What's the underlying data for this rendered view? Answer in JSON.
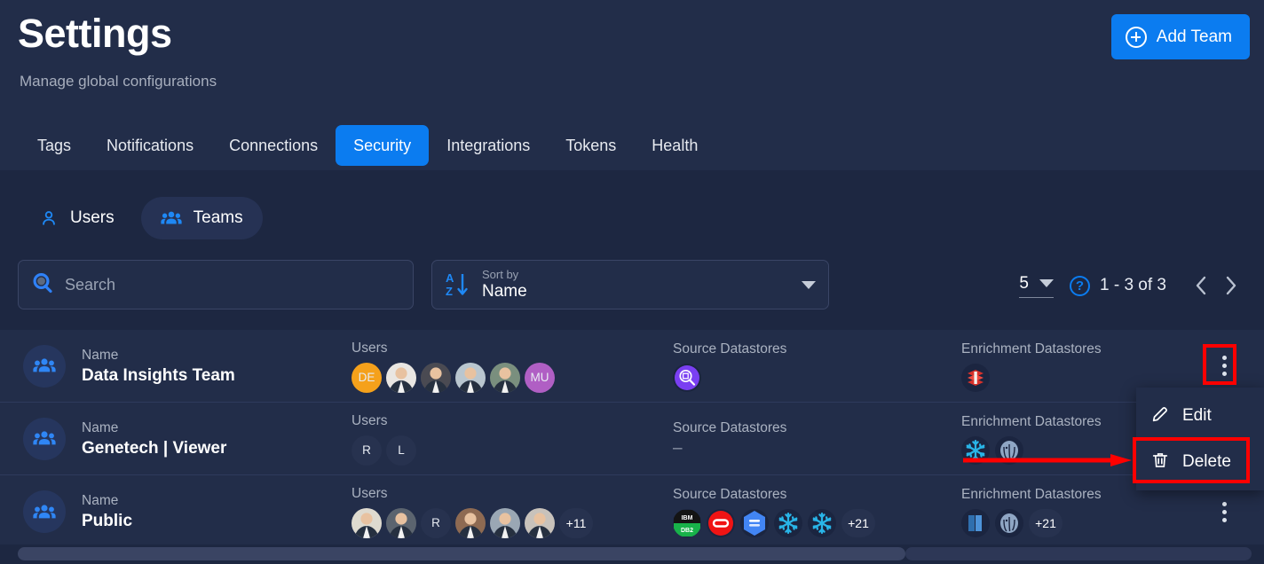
{
  "header": {
    "title": "Settings",
    "subtitle": "Manage global configurations",
    "add_team_label": "Add Team",
    "add_icon": "plus-circle-icon"
  },
  "tabs": [
    {
      "label": "Tags",
      "active": false
    },
    {
      "label": "Notifications",
      "active": false
    },
    {
      "label": "Connections",
      "active": false
    },
    {
      "label": "Security",
      "active": true
    },
    {
      "label": "Integrations",
      "active": false
    },
    {
      "label": "Tokens",
      "active": false
    },
    {
      "label": "Health",
      "active": false
    }
  ],
  "subnav": [
    {
      "label": "Users",
      "icon": "person-icon",
      "active": false
    },
    {
      "label": "Teams",
      "icon": "people-icon",
      "active": true
    }
  ],
  "filters": {
    "search_placeholder": "Search",
    "search_value": "",
    "search_icon": "search-icon",
    "sort_label": "Sort by",
    "sort_value": "Name",
    "sort_icon": "sort-alpha-down-icon",
    "sort_caret": "chevron-down-icon"
  },
  "pagination": {
    "page_size": "5",
    "page_size_caret": "chevron-down-icon",
    "help_icon": "help-circle-icon",
    "help_glyph": "?",
    "range": "1 - 3 of 3",
    "prev_icon": "chevron-left-icon",
    "next_icon": "chevron-right-icon",
    "prev_glyph": "‹",
    "next_glyph": "›"
  },
  "columns": {
    "name": "Name",
    "users": "Users",
    "source_datastores": "Source Datastores",
    "enrichment_datastores": "Enrichment Datastores"
  },
  "rows": [
    {
      "name": "Data Insights Team",
      "team_icon": "people-icon",
      "users": [
        {
          "type": "initials",
          "label": "DE",
          "color": "#f5a11b"
        },
        {
          "type": "photo",
          "label": "",
          "color": "#e9e6e2"
        },
        {
          "type": "photo",
          "label": "",
          "color": "#4a4a52"
        },
        {
          "type": "photo",
          "label": "",
          "color": "#b9c6cf"
        },
        {
          "type": "photo",
          "label": "",
          "color": "#7a8f7e"
        },
        {
          "type": "initials",
          "label": "MU",
          "color": "#b05fc4"
        }
      ],
      "users_overflow": "",
      "source_datastores": [
        {
          "icon": "databricks-search-icon",
          "color": "#7a3ff2"
        }
      ],
      "source_dash": "",
      "source_overflow": "",
      "enrichment_datastores": [
        {
          "icon": "redis-icon",
          "color": "#d8312a"
        }
      ],
      "enrichment_overflow": "",
      "menu_open": true
    },
    {
      "name": "Genetech | Viewer",
      "team_icon": "people-icon",
      "users": [
        {
          "type": "initials",
          "label": "R",
          "color": "#27324f"
        },
        {
          "type": "initials",
          "label": "L",
          "color": "#27324f"
        }
      ],
      "users_overflow": "",
      "source_datastores": [],
      "source_dash": "–",
      "source_overflow": "",
      "enrichment_datastores": [
        {
          "icon": "snowflake-icon",
          "color": "#29b5e8"
        },
        {
          "icon": "postgresql-icon",
          "color": "#8fa6c4"
        }
      ],
      "enrichment_overflow": "",
      "menu_open": false
    },
    {
      "name": "Public",
      "team_icon": "people-icon",
      "users": [
        {
          "type": "photo",
          "label": "",
          "color": "#dedacf"
        },
        {
          "type": "photo",
          "label": "",
          "color": "#5b646f"
        },
        {
          "type": "initials",
          "label": "R",
          "color": "#27324f"
        },
        {
          "type": "photo",
          "label": "",
          "color": "#8e6a52"
        },
        {
          "type": "photo",
          "label": "",
          "color": "#9aa7b4"
        },
        {
          "type": "photo",
          "label": "",
          "color": "#c8c2bb"
        }
      ],
      "users_overflow": "+11",
      "source_datastores": [
        {
          "icon": "ibm-db2-icon",
          "color": "#18b24a"
        },
        {
          "icon": "oracle-icon",
          "color": "#f01414"
        },
        {
          "icon": "google-bigquery-icon",
          "color": "#4285f4"
        },
        {
          "icon": "snowflake-icon",
          "color": "#29b5e8"
        },
        {
          "icon": "snowflake-icon",
          "color": "#29b5e8"
        }
      ],
      "source_dash": "",
      "source_overflow": "+21",
      "enrichment_datastores": [
        {
          "icon": "amazon-redshift-icon",
          "color": "#4d93d9"
        },
        {
          "icon": "postgresql-icon",
          "color": "#8fa6c4"
        }
      ],
      "enrichment_overflow": "+21",
      "menu_open": false
    }
  ],
  "context_menu": {
    "items": [
      {
        "label": "Edit",
        "icon": "pencil-icon"
      },
      {
        "label": "Delete",
        "icon": "trash-icon"
      }
    ]
  },
  "annotations": {
    "kebab_highlight": "red-box-on-kebab-menu",
    "delete_highlight": "red-box-on-delete-item",
    "arrow": "red-arrow-pointing-to-delete"
  },
  "colors": {
    "accent": "#0b7cf0",
    "page_bg": "#1d2741",
    "panel_bg": "#222d49",
    "annotation": "#ff0000"
  }
}
